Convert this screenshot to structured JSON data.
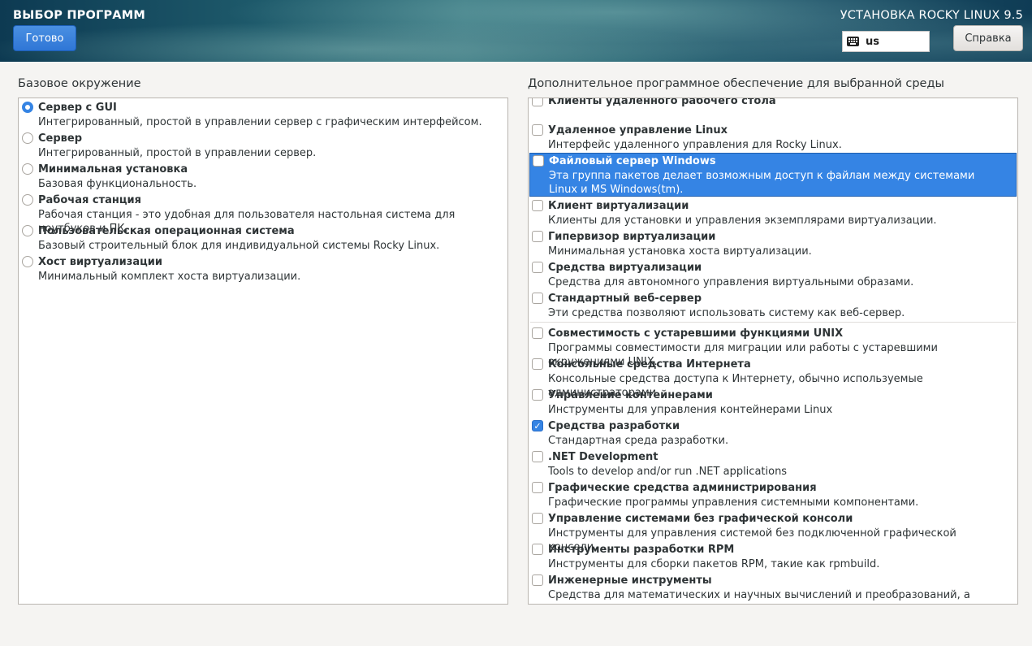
{
  "header": {
    "page_title": "ВЫБОР ПРОГРАММ",
    "done_label": "Готово",
    "install_title": "УСТАНОВКА ROCKY LINUX 9.5",
    "keyboard_layout": "us",
    "help_label": "Справка"
  },
  "base_env": {
    "label": "Базовое окружение",
    "items": [
      {
        "title": "Сервер с GUI",
        "desc": "Интегрированный, простой в управлении сервер с графическим интерфейсом.",
        "selected": true
      },
      {
        "title": "Сервер",
        "desc": "Интегрированный, простой в управлении сервер.",
        "selected": false
      },
      {
        "title": "Минимальная установка",
        "desc": "Базовая функциональность.",
        "selected": false
      },
      {
        "title": "Рабочая станция",
        "desc": "Рабочая станция - это удобная для пользователя настольная система для ноутбуков и ПК.",
        "selected": false
      },
      {
        "title": "Пользовательская операционная система",
        "desc": "Базовый строительный блок для индивидуальной системы Rocky Linux.",
        "selected": false
      },
      {
        "title": "Хост виртуализации",
        "desc": "Минимальный комплект хоста виртуализации.",
        "selected": false
      }
    ]
  },
  "addons": {
    "label": "Дополнительное программное обеспечение для выбранной среды",
    "items": [
      {
        "title": "Клиенты удаленного рабочего стола",
        "desc": "",
        "checked": false
      },
      {
        "title": "Удаленное управление Linux",
        "desc": "Интерфейс удаленного управления для Rocky Linux.",
        "checked": false
      },
      {
        "title": "Файловый сервер Windows",
        "desc": "Эта группа пакетов делает возможным доступ к файлам между системами Linux и MS Windows(tm).",
        "checked": false,
        "highlighted": true
      },
      {
        "title": "Клиент виртуализации",
        "desc": "Клиенты для установки и управления экземплярами виртуализации.",
        "checked": false
      },
      {
        "title": "Гипервизор виртуализации",
        "desc": "Минимальная установка хоста виртуализации.",
        "checked": false
      },
      {
        "title": "Средства виртуализации",
        "desc": "Средства для автономного управления виртуальными образами.",
        "checked": false
      },
      {
        "title": "Стандартный веб-сервер",
        "desc": "Эти средства позволяют использовать систему как веб-сервер.",
        "checked": false
      },
      {
        "title": "Совместимость с устаревшими функциями UNIX",
        "desc": "Программы совместимости для миграции или работы с устаревшими окружениями UNIX.",
        "checked": false
      },
      {
        "title": "Консольные средства Интернета",
        "desc": "Консольные средства доступа к Интернету, обычно используемые администраторами.",
        "checked": false
      },
      {
        "title": "Управление контейнерами",
        "desc": "Инструменты для управления контейнерами Linux",
        "checked": false
      },
      {
        "title": "Средства разработки",
        "desc": "Стандартная среда разработки.",
        "checked": true
      },
      {
        "title": ".NET Development",
        "desc": "Tools to develop and/or run .NET applications",
        "checked": false
      },
      {
        "title": "Графические средства администрирования",
        "desc": "Графические программы управления системными компонентами.",
        "checked": false
      },
      {
        "title": "Управление системами без графической консоли",
        "desc": "Инструменты для управления системой без подключенной графической консоли.",
        "checked": false
      },
      {
        "title": "Инструменты разработки RPM",
        "desc": "Инструменты для сборки пакетов RPM, такие как rpmbuild.",
        "checked": false
      },
      {
        "title": "Инженерные инструменты",
        "desc": "Средства для математических и научных вычислений и преобразований, а также",
        "checked": false
      }
    ]
  },
  "colors": {
    "accent": "#3584e4"
  },
  "icons": {
    "keyboard": "keyboard-icon",
    "check": "✓"
  }
}
